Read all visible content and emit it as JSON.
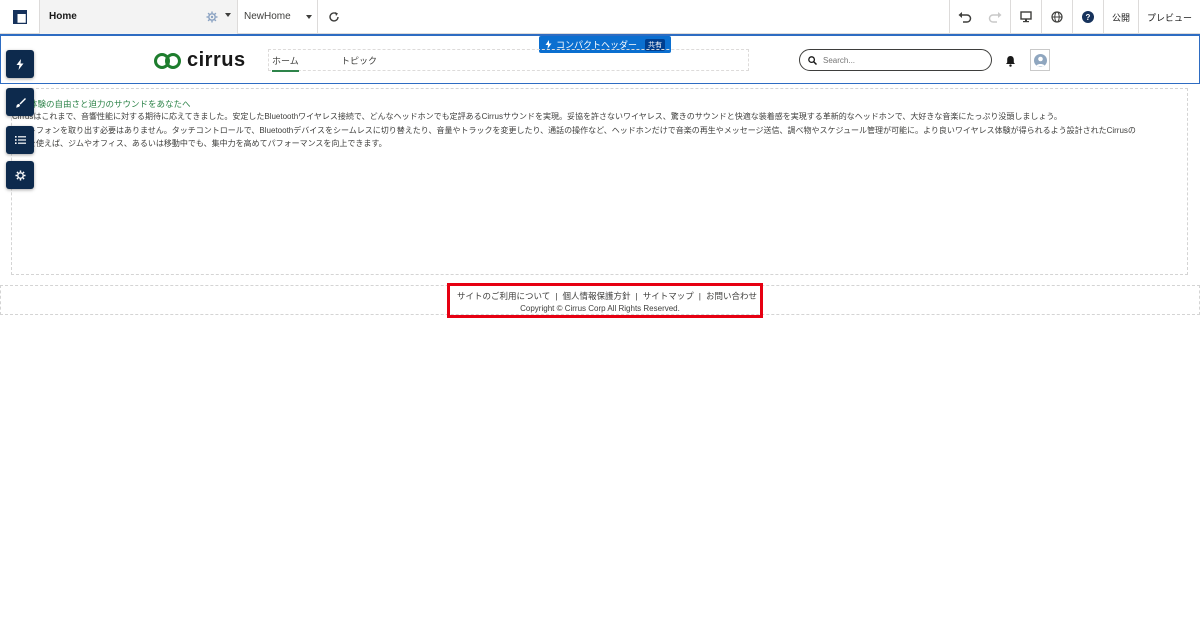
{
  "toolbar": {
    "page_name": "Home",
    "home_selector": "NewHome",
    "publish_label": "公開",
    "preview_label": "プレビュー",
    "help_glyph": "?"
  },
  "header": {
    "badge_label": "コンパクトヘッダー",
    "badge_tag": "共有",
    "logo_text": "cirrus",
    "nav": [
      {
        "label": "ホーム",
        "active": true
      },
      {
        "label": "トピック",
        "active": false
      }
    ],
    "search_placeholder": "Search..."
  },
  "content": {
    "heading": "ング体験の自由さと迫力のサウンドをあなたへ",
    "lines": [
      "Cirrusはこれまで、音響性能に対する期待に応えてきました。安定したBluetoothワイヤレス接続で、どんなヘッドホンでも定評あるCirrusサウンドを実現。妥協を許さないワイヤレス、驚きのサウンドと快適な装着感を実現する革新的なヘッドホンで、大好きな音楽にたっぷり没頭しましょう。",
      "マートフォンを取り出す必要はありません。タッチコントロールで、Bluetoothデバイスをシームレスに切り替えたり、音量やトラックを変更したり、通話の操作など、ヘッドホンだけで音楽の再生やメッセージ送信、調べ物やスケジュール管理が可能に。より良いワイヤレス体験が得られるよう設計されたCirrusの",
      "ホンを使えば、ジムやオフィス、あるいは移動中でも、集中力を高めてパフォーマンスを向上できます。"
    ]
  },
  "footer": {
    "links": [
      "サイトのご利用について",
      "個人情報保護方針",
      "サイトマップ",
      "お問い合わせ"
    ],
    "separator": "|",
    "copyright": "Copyright © Cirrus Corp All Rights Reserved."
  },
  "colors": {
    "accent_blue": "#0b6fd0",
    "navy": "#0d2a4d",
    "green": "#2e844a",
    "highlight": "#e60012"
  }
}
